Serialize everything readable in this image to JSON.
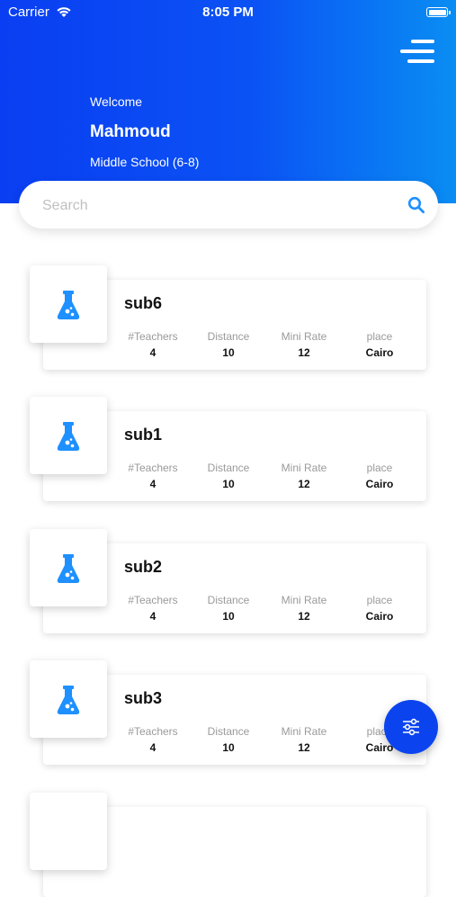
{
  "status_bar": {
    "carrier": "Carrier",
    "time": "8:05 PM"
  },
  "header": {
    "welcome": "Welcome",
    "user_name": "Mahmoud",
    "school_level": "Middle School (6-8)"
  },
  "search": {
    "placeholder": "Search"
  },
  "stat_labels": {
    "teachers": "#Teachers",
    "distance": "Distance",
    "mini_rate": "Mini Rate",
    "place": "place"
  },
  "subjects": [
    {
      "name": "sub6",
      "teachers": "4",
      "distance": "10",
      "mini_rate": "12",
      "place": "Cairo"
    },
    {
      "name": "sub1",
      "teachers": "4",
      "distance": "10",
      "mini_rate": "12",
      "place": "Cairo"
    },
    {
      "name": "sub2",
      "teachers": "4",
      "distance": "10",
      "mini_rate": "12",
      "place": "Cairo"
    },
    {
      "name": "sub3",
      "teachers": "4",
      "distance": "10",
      "mini_rate": "12",
      "place": "Cairo"
    }
  ],
  "icons": {
    "subject": "flask-icon",
    "fab": "filter-sliders-icon",
    "menu": "hamburger-menu-icon",
    "search": "search-icon"
  },
  "colors": {
    "primary": "#0a3ef2",
    "accent": "#1e90ff",
    "fab": "#0b44ef"
  }
}
